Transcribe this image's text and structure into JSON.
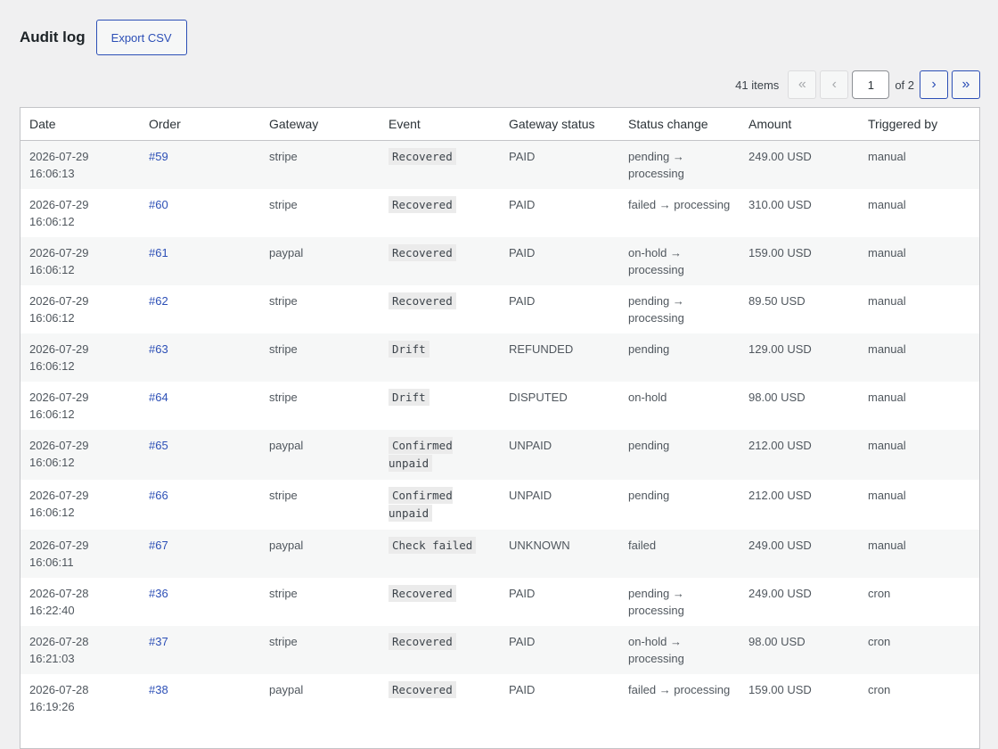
{
  "header": {
    "title": "Audit log",
    "export_label": "Export CSV"
  },
  "pagination": {
    "items_label": "41 items",
    "first": "«",
    "prev": "‹",
    "next": "›",
    "last": "»",
    "current_page": "1",
    "of_label": "of 2"
  },
  "table": {
    "columns": [
      "Date",
      "Order",
      "Gateway",
      "Event",
      "Gateway status",
      "Status change",
      "Amount",
      "Triggered by"
    ],
    "rows": [
      {
        "date": "2026-07-29 16:06:13",
        "order": "#59",
        "gateway": "stripe",
        "event": "Recovered",
        "gateway_status": "PAID",
        "status_change": "pending → processing",
        "amount": "249.00 USD",
        "triggered_by": "manual"
      },
      {
        "date": "2026-07-29 16:06:12",
        "order": "#60",
        "gateway": "stripe",
        "event": "Recovered",
        "gateway_status": "PAID",
        "status_change": "failed → processing",
        "amount": "310.00 USD",
        "triggered_by": "manual"
      },
      {
        "date": "2026-07-29 16:06:12",
        "order": "#61",
        "gateway": "paypal",
        "event": "Recovered",
        "gateway_status": "PAID",
        "status_change": "on-hold → processing",
        "amount": "159.00 USD",
        "triggered_by": "manual"
      },
      {
        "date": "2026-07-29 16:06:12",
        "order": "#62",
        "gateway": "stripe",
        "event": "Recovered",
        "gateway_status": "PAID",
        "status_change": "pending → processing",
        "amount": "89.50 USD",
        "triggered_by": "manual"
      },
      {
        "date": "2026-07-29 16:06:12",
        "order": "#63",
        "gateway": "stripe",
        "event": "Drift",
        "gateway_status": "REFUNDED",
        "status_change": "pending",
        "amount": "129.00 USD",
        "triggered_by": "manual"
      },
      {
        "date": "2026-07-29 16:06:12",
        "order": "#64",
        "gateway": "stripe",
        "event": "Drift",
        "gateway_status": "DISPUTED",
        "status_change": "on-hold",
        "amount": "98.00 USD",
        "triggered_by": "manual"
      },
      {
        "date": "2026-07-29 16:06:12",
        "order": "#65",
        "gateway": "paypal",
        "event": "Confirmed unpaid",
        "gateway_status": "UNPAID",
        "status_change": "pending",
        "amount": "212.00 USD",
        "triggered_by": "manual"
      },
      {
        "date": "2026-07-29 16:06:12",
        "order": "#66",
        "gateway": "stripe",
        "event": "Confirmed unpaid",
        "gateway_status": "UNPAID",
        "status_change": "pending",
        "amount": "212.00 USD",
        "triggered_by": "manual"
      },
      {
        "date": "2026-07-29 16:06:11",
        "order": "#67",
        "gateway": "paypal",
        "event": "Check failed",
        "gateway_status": "UNKNOWN",
        "status_change": "failed",
        "amount": "249.00 USD",
        "triggered_by": "manual"
      },
      {
        "date": "2026-07-28 16:22:40",
        "order": "#36",
        "gateway": "stripe",
        "event": "Recovered",
        "gateway_status": "PAID",
        "status_change": "pending → processing",
        "amount": "249.00 USD",
        "triggered_by": "cron"
      },
      {
        "date": "2026-07-28 16:21:03",
        "order": "#37",
        "gateway": "stripe",
        "event": "Recovered",
        "gateway_status": "PAID",
        "status_change": "on-hold → processing",
        "amount": "98.00 USD",
        "triggered_by": "cron"
      },
      {
        "date": "2026-07-28 16:19:26",
        "order": "#38",
        "gateway": "paypal",
        "event": "Recovered",
        "gateway_status": "PAID",
        "status_change": "failed → processing",
        "amount": "159.00 USD",
        "triggered_by": "cron"
      }
    ]
  }
}
